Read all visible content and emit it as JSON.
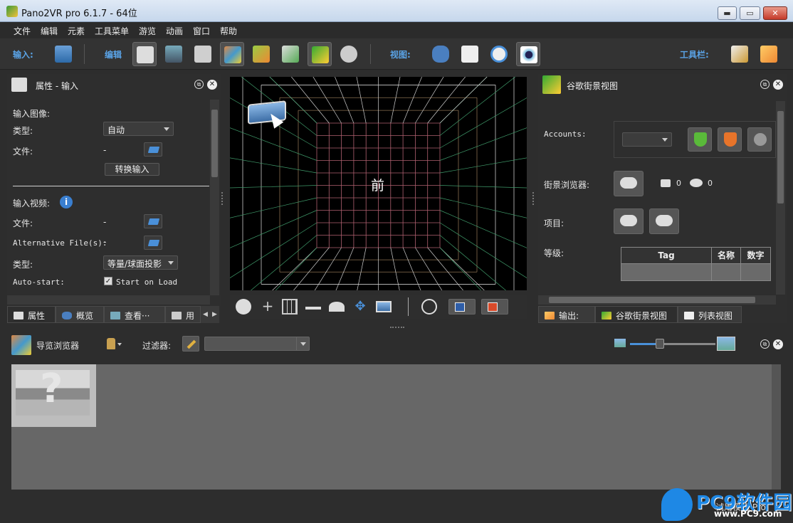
{
  "window": {
    "title": "Pano2VR pro 6.1.7 - 64位",
    "minimize": "▬",
    "maximize": "▭",
    "close": "✕"
  },
  "menu": [
    "文件",
    "编辑",
    "元素",
    "工具菜单",
    "游览",
    "动画",
    "窗口",
    "帮助"
  ],
  "toolbar": {
    "input_label": "输入:",
    "edit_label": "编辑",
    "view_label": "视图:",
    "tools_label": "工具栏:"
  },
  "properties_panel": {
    "title": "属性 - 输入",
    "input_image_label": "输入图像:",
    "type_label": "类型:",
    "type_value": "自动",
    "file_label": "文件:",
    "file_value": "-",
    "convert_button": "转换输入",
    "input_video_label": "输入视频:",
    "video_file_label": "文件:",
    "video_file_value": "-",
    "alt_file_label": "Alternative File(s):",
    "alt_file_value": "-",
    "video_type_label": "类型:",
    "video_type_value": "等量/球面投影",
    "autostart_label": "Auto-start:",
    "autostart_checkbox": "✓",
    "autostart_option": "Start on Load",
    "tabs": [
      "属性",
      "概览",
      "查看···",
      "用"
    ]
  },
  "viewport": {
    "face_label": "前"
  },
  "streetview_panel": {
    "title": "谷歌街景视图",
    "accounts_label": "Accounts:",
    "browser_label": "街景浏览器:",
    "photo_count": "0",
    "view_count": "0",
    "project_label": "项目:",
    "level_label": "等级:",
    "table_headers": [
      "Tag",
      "名称",
      "数字"
    ],
    "tabs": [
      "输出:",
      "谷歌街景视图",
      "列表视图"
    ]
  },
  "tour_browser": {
    "title": "导览浏览器",
    "filter_label": "过滤器:"
  },
  "status": {
    "trial_text": "试用模式 Pro"
  },
  "watermark": {
    "logo_text": "PC9软件园",
    "url": "www.PC9.com"
  }
}
